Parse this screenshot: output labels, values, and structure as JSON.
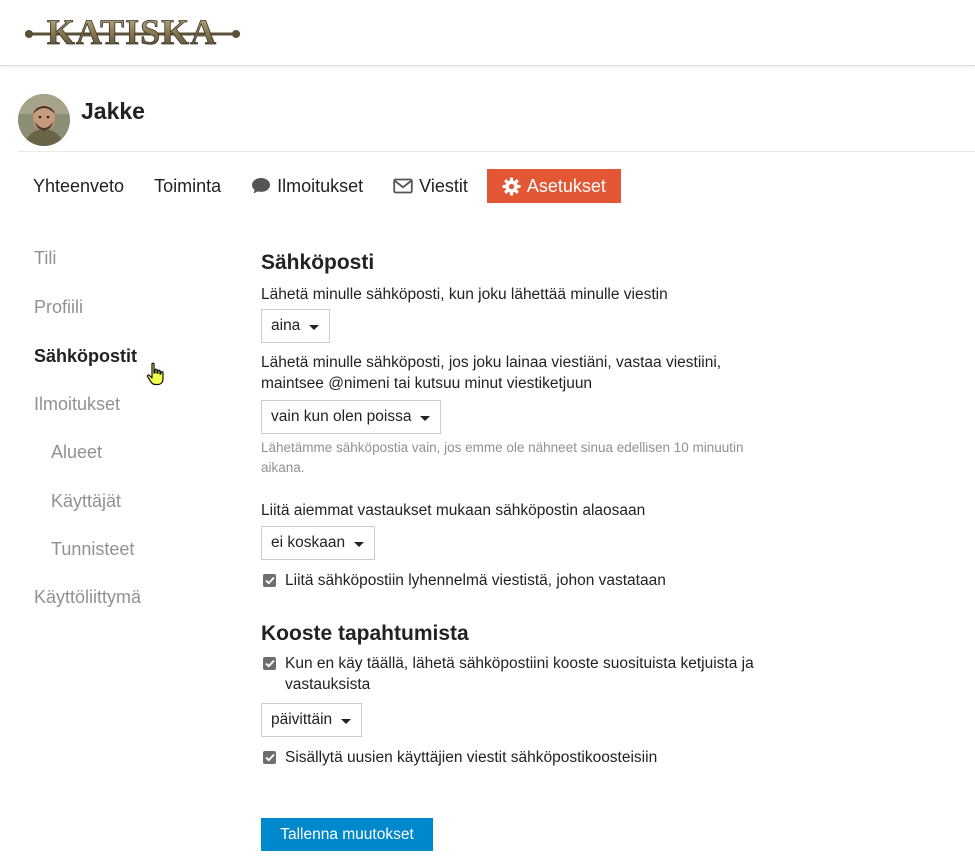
{
  "brand": {
    "logo_text": "KATISKA"
  },
  "user": {
    "name": "Jakke"
  },
  "nav": {
    "summary": "Yhteenveto",
    "activity": "Toiminta",
    "notifications": "Ilmoitukset",
    "messages": "Viestit",
    "preferences": "Asetukset"
  },
  "sidebar": {
    "items": [
      {
        "label": "Tili"
      },
      {
        "label": "Profiili"
      },
      {
        "label": "Sähköpostit"
      },
      {
        "label": "Ilmoitukset"
      },
      {
        "label": "Alueet"
      },
      {
        "label": "Käyttäjät"
      },
      {
        "label": "Tunnisteet"
      },
      {
        "label": "Käyttöliittymä"
      }
    ]
  },
  "email": {
    "heading": "Sähköposti",
    "pm_label": "Lähetä minulle sähköposti, kun joku lähettää minulle viestin",
    "pm_value": "aina",
    "mention_label_1": "Lähetä minulle sähköposti, jos joku lainaa viestiäni, vastaa viestiini,",
    "mention_label_2": "maintsee @nimeni tai kutsuu minut viestiketjuun",
    "mention_value": "vain kun olen poissa",
    "mention_note_1": "Lähetämme sähköpostia vain, jos emme ole nähneet sinua edellisen 10 minuutin",
    "mention_note_2": "aikana.",
    "previous_label": "Liitä aiemmat vastaukset mukaan sähköpostin alaosaan",
    "previous_value": "ei koskaan",
    "excerpt_label": "Liitä sähköpostiin lyhennelmä viestistä, johon vastataan",
    "excerpt_checked": true
  },
  "digest": {
    "heading": "Kooste tapahtumista",
    "digest_label_1": "Kun en käy täällä, lähetä sähköpostiini kooste suosituista ketjuista ja",
    "digest_label_2": "vastauksista",
    "digest_checked": true,
    "frequency_value": "päivittäin",
    "new_users_label": "Sisällytä uusien käyttäjien viestit sähköpostikoosteisiin",
    "new_users_checked": true
  },
  "actions": {
    "save_label": "Tallenna muutokset"
  },
  "colors": {
    "accent": "#e45735",
    "primary_button": "#0088cc",
    "muted_text": "#919191"
  }
}
